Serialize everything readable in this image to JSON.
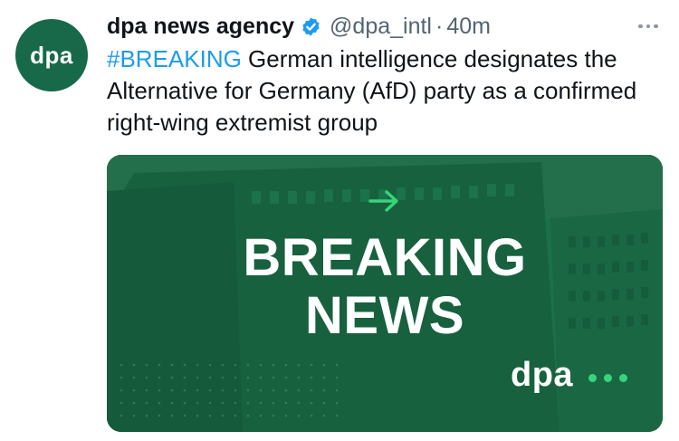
{
  "account": {
    "avatar_text": "dpa",
    "display_name": "dpa news agency",
    "handle": "@dpa_intl",
    "separator": "·",
    "time": "40m",
    "verified_color": "#1d9bf0"
  },
  "tweet": {
    "hashtag": "#BREAKING",
    "text": " German intelligence designates the Alternative for Germany (AfD) party as a confirmed right-wing extremist group"
  },
  "media": {
    "headline_line1": "BREAKING",
    "headline_line2": "NEWS",
    "brand": "dpa",
    "background_color": "#1c7047",
    "accent_color": "#35d67a"
  },
  "icons": {
    "more": "more-icon",
    "verified": "verified-badge-icon",
    "arrow": "arrow-right-icon"
  }
}
